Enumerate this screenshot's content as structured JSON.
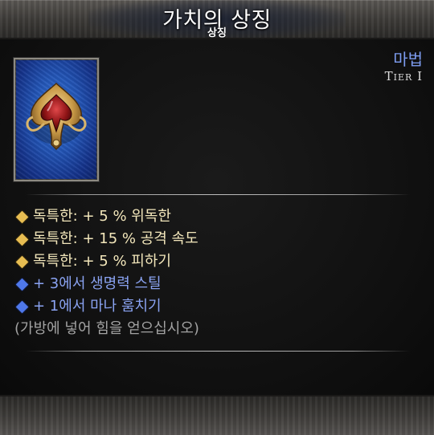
{
  "header": {
    "title": "가치의 상징",
    "subtitle": "상징"
  },
  "item": {
    "rarity": "마법",
    "tier": "Tier I",
    "icon": "spade-crest-emblem-icon",
    "frame_color": "#2356b8"
  },
  "stats": [
    {
      "text": "독특한: + 5 % 위독한",
      "kind": "unique",
      "color": "#e7bd52"
    },
    {
      "text": "독특한: + 15 % 공격 속도",
      "kind": "unique",
      "color": "#e7bd52"
    },
    {
      "text": "독특한: + 5 % 피하기",
      "kind": "unique",
      "color": "#e7bd52"
    },
    {
      "text": "+ 3에서 생명력 스틸",
      "kind": "magic",
      "color": "#4f78ea"
    },
    {
      "text": "+ 1에서 마나 훔치기",
      "kind": "magic",
      "color": "#4f78ea"
    }
  ],
  "hint": "(가방에 넣어 힘을 얻으십시오)"
}
